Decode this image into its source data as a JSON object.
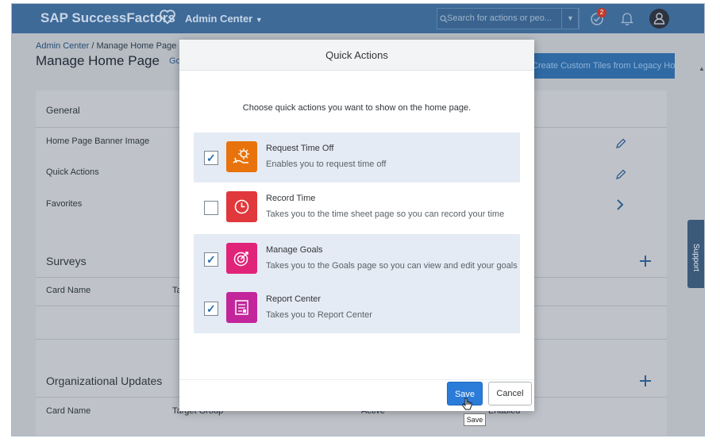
{
  "topbar": {
    "brand": "SAP SuccessFactors",
    "module": "Admin Center",
    "search_placeholder": "Search for actions or peo...",
    "notification_count": "2"
  },
  "page": {
    "breadcrumb_link": "Admin Center",
    "breadcrumb_current": "Manage Home Page",
    "title": "Manage Home Page",
    "tab_partial": "Go",
    "legacy_button": "Create Custom Tiles from Legacy Home Page",
    "general": {
      "heading": "General",
      "rows": [
        "Home Page Banner Image",
        "Quick Actions",
        "Favorites"
      ]
    },
    "surveys": {
      "heading": "Surveys",
      "col_card_name": "Card Name",
      "col_partial": "Ta"
    },
    "org_updates": {
      "heading": "Organizational Updates",
      "cols": [
        "Card Name",
        "Target Group",
        "Active",
        "Enabled"
      ]
    },
    "support_tab": "Support"
  },
  "modal": {
    "title": "Quick Actions",
    "intro": "Choose quick actions you want to show on the home page.",
    "items": [
      {
        "title": "Request Time Off",
        "desc": "Enables you to request time off",
        "checked": true,
        "color": "#e8730c",
        "icon": "time-off-icon"
      },
      {
        "title": "Record Time",
        "desc": "Takes you to the time sheet page so you can record your time",
        "checked": false,
        "color": "#e0383c",
        "icon": "clock-icon"
      },
      {
        "title": "Manage Goals",
        "desc": "Takes you to the Goals page so you can view and edit your goals",
        "checked": true,
        "color": "#e0247a",
        "icon": "target-icon"
      },
      {
        "title": "Report Center",
        "desc": "Takes you to Report Center",
        "checked": true,
        "color": "#c2269a",
        "icon": "report-icon"
      }
    ],
    "save_label": "Save",
    "cancel_label": "Cancel",
    "tooltip": "Save"
  }
}
